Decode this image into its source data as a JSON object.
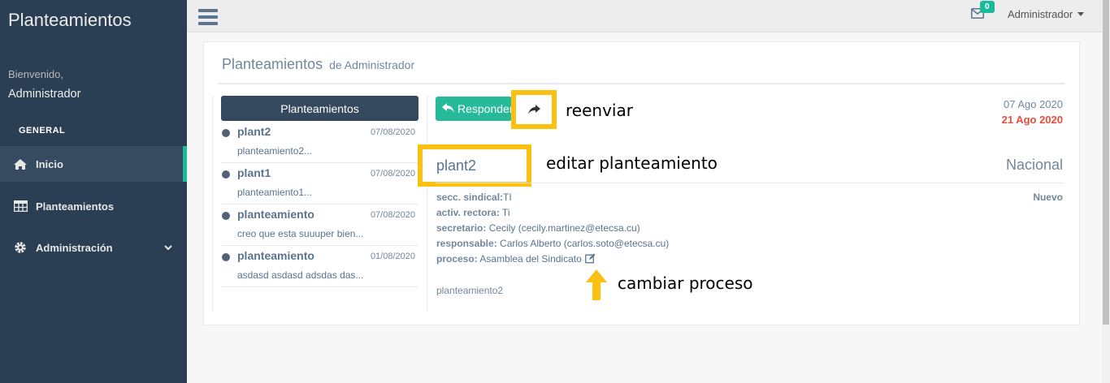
{
  "sidebar": {
    "brand": "Planteamientos",
    "welcome": "Bienvenido,",
    "user": "Administrador",
    "section": "GENERAL",
    "items": [
      {
        "label": "Inicio",
        "icon": "home-icon"
      },
      {
        "label": "Planteamientos",
        "icon": "table-icon"
      },
      {
        "label": "Administración",
        "icon": "gear-icon"
      }
    ]
  },
  "topnav": {
    "mail_count": "0",
    "user_label": "Administrador"
  },
  "panel": {
    "title": "Planteamientos",
    "subtitle": "de Administrador"
  },
  "list": {
    "header": "Planteamientos",
    "items": [
      {
        "title": "plant2",
        "date": "07/08/2020",
        "preview": "planteamiento2..."
      },
      {
        "title": "plant1",
        "date": "07/08/2020",
        "preview": "planteamiento1..."
      },
      {
        "title": "planteamiento",
        "date": "07/08/2020",
        "preview": "creo que esta suuuper bien..."
      },
      {
        "title": "planteamiento",
        "date": "01/08/2020",
        "preview": "asdasd asdasd adsdas das..."
      }
    ]
  },
  "detail": {
    "reply_label": "Responder",
    "date": "07 Ago 2020",
    "deadline": "21 Ago 2020",
    "title": "plant2",
    "scope": "Nacional",
    "status": "Nuevo",
    "fields": [
      {
        "label": "secc. sindical:",
        "value": "TI"
      },
      {
        "label": "activ. rectora:",
        "value": " Ti"
      },
      {
        "label": "secretario:",
        "value": " Cecily (cecily.martinez@etecsa.cu)"
      },
      {
        "label": "responsable:",
        "value": " Carlos Alberto (carlos.soto@etecsa.cu)"
      },
      {
        "label": "proceso:",
        "value": " Asamblea del Sindicato"
      }
    ],
    "body": "planteamiento2"
  },
  "annotations": {
    "forward": "reenviar",
    "edit": "editar planteamiento",
    "process": "cambiar proceso"
  },
  "colors": {
    "sidebar": "#2a3f54",
    "accent": "#1abb9c",
    "reply": "#26b99a",
    "highlight": "#fcc010",
    "danger": "#e74c3c"
  }
}
